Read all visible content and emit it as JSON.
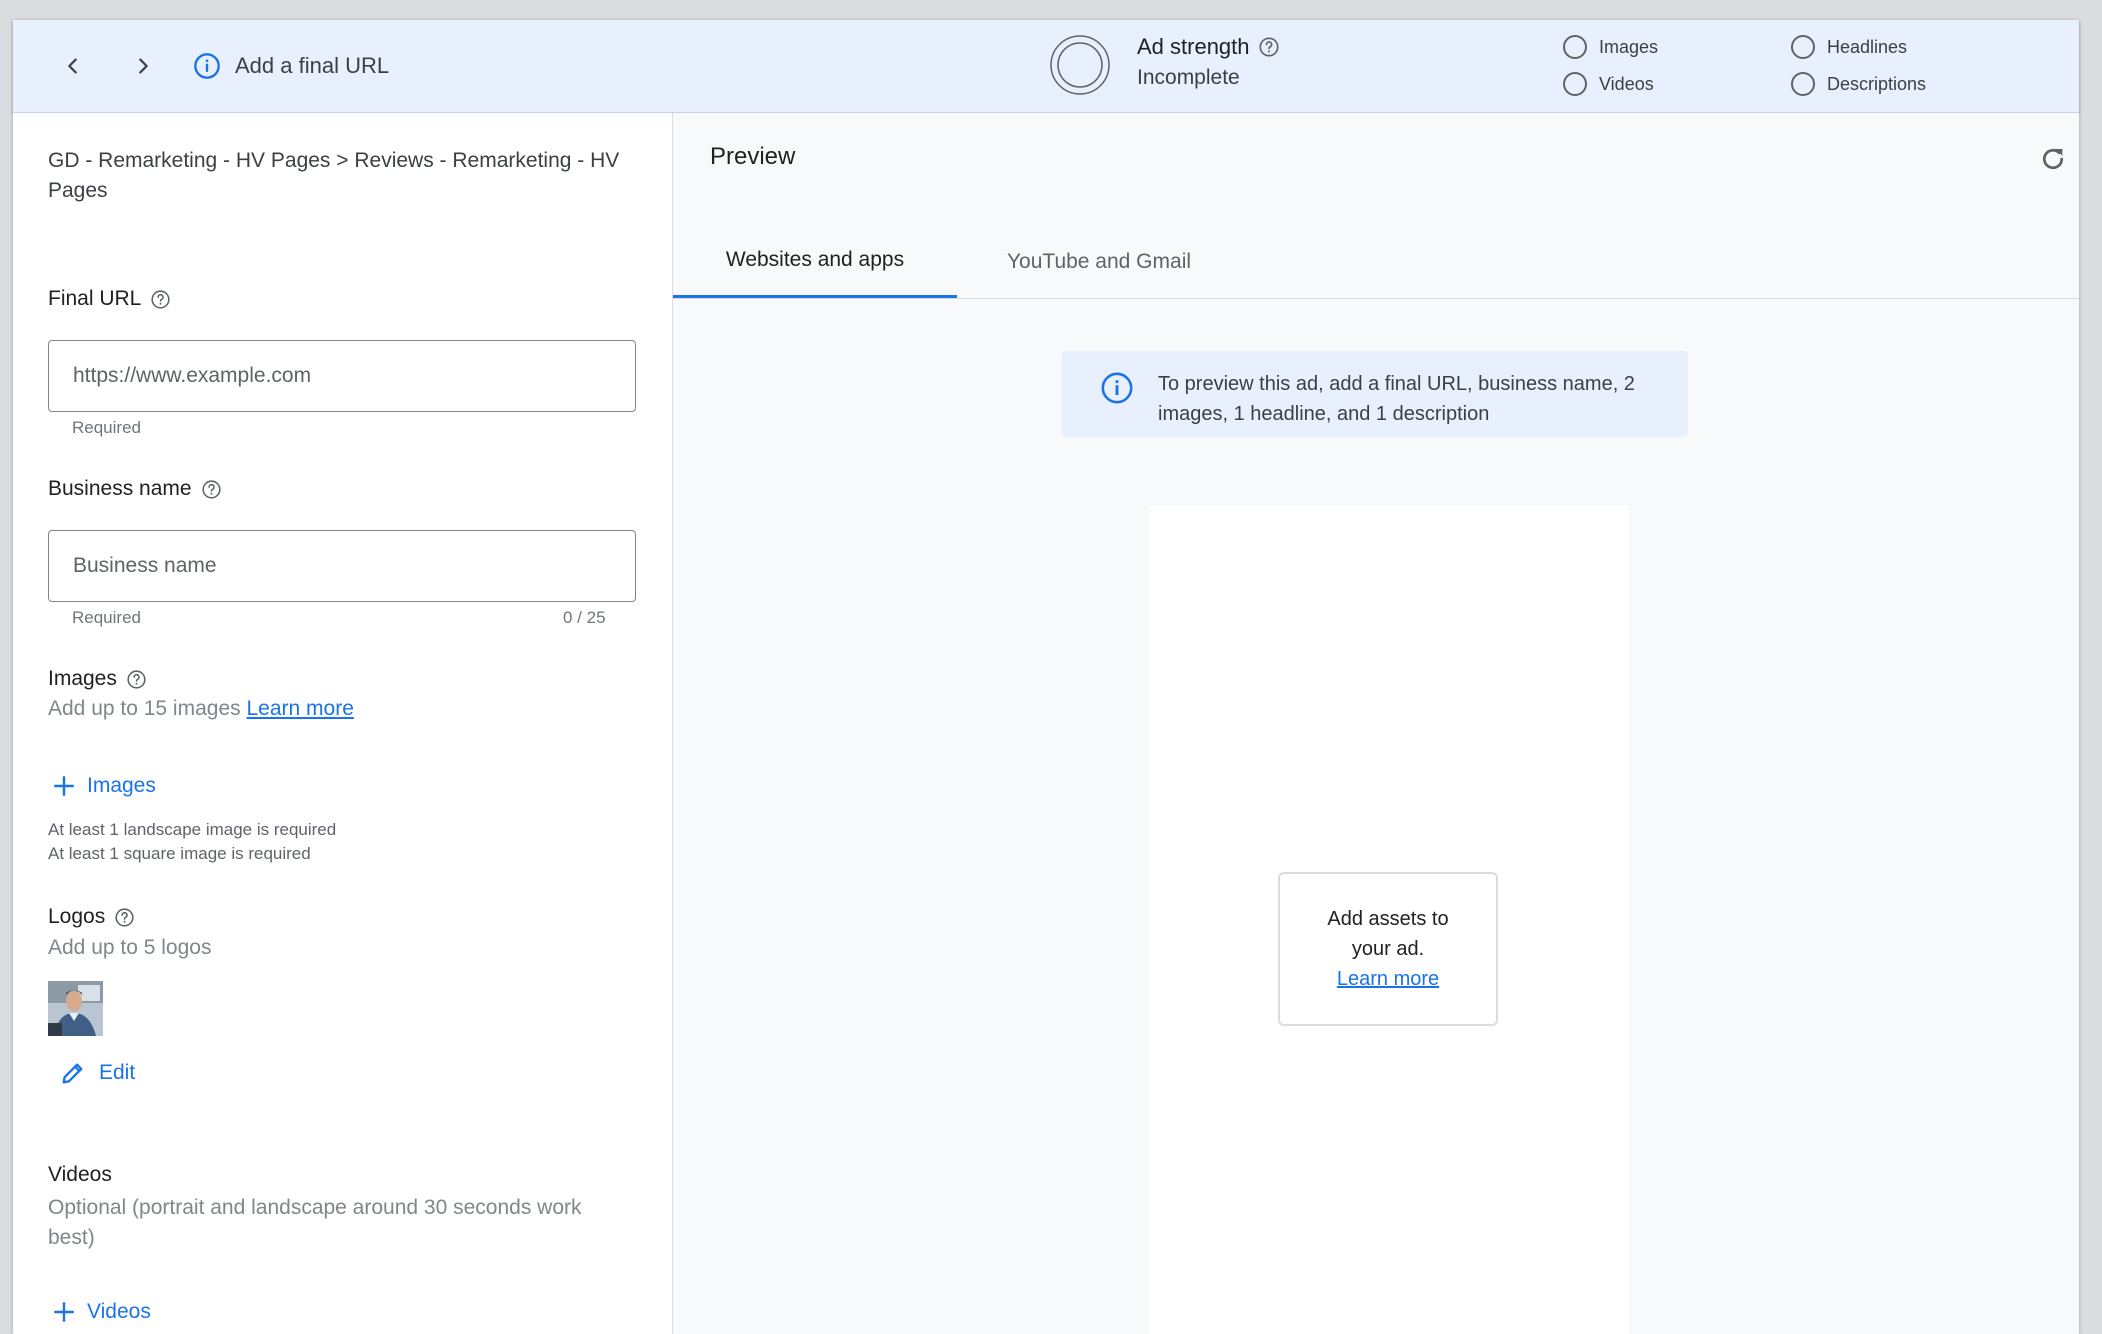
{
  "topbar": {
    "back_icon": "chevron-left-icon",
    "forward_icon": "chevron-right-icon",
    "info_icon": "info-icon",
    "message": "Add a final URL",
    "ad_strength": {
      "title": "Ad strength",
      "status": "Incomplete"
    },
    "requirements": [
      {
        "label": "Images"
      },
      {
        "label": "Videos"
      },
      {
        "label": "Headlines"
      },
      {
        "label": "Descriptions"
      }
    ]
  },
  "form": {
    "breadcrumb": "GD - Remarketing - HV Pages > Reviews - Remarketing - HV Pages",
    "final_url": {
      "label": "Final URL",
      "placeholder": "https://www.example.com",
      "value": "",
      "helper": "Required"
    },
    "business_name": {
      "label": "Business name",
      "placeholder": "Business name",
      "value": "",
      "helper": "Required",
      "counter": "0 / 25"
    },
    "images": {
      "label": "Images",
      "description": "Add up to 15 images",
      "learn_more": "Learn more",
      "add_label": "Images",
      "notes": [
        "At least 1 landscape image is required",
        "At least 1 square image is required"
      ]
    },
    "logos": {
      "label": "Logos",
      "description": "Add up to 5 logos",
      "edit_label": "Edit"
    },
    "videos": {
      "label": "Videos",
      "description": "Optional (portrait and landscape around 30 seconds work best)",
      "add_label": "Videos"
    }
  },
  "preview": {
    "title": "Preview",
    "refresh_icon": "refresh-icon",
    "tabs": [
      {
        "label": "Websites and apps",
        "active": true
      },
      {
        "label": "YouTube and Gmail",
        "active": false
      }
    ],
    "banner": {
      "icon": "info-icon",
      "message": "To preview this ad, add a final URL, business name, 2 images, 1 headline, and 1 description"
    },
    "placeholder_card": {
      "text": "Add assets to your ad.",
      "link": "Learn more"
    }
  },
  "colors": {
    "accent": "#1a73e8",
    "topbar_bg": "#e8f0fe",
    "banner_bg": "#e8f0fe"
  }
}
